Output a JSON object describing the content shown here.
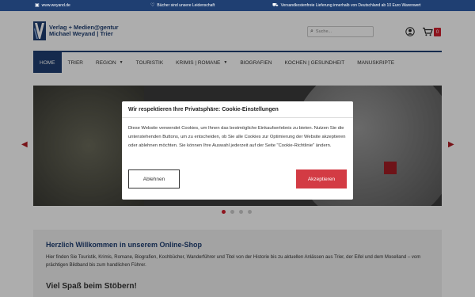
{
  "topbar": {
    "site_url": "www.weyand.de",
    "readership": "Bücher sind unsere Leidenschaft",
    "delivery": "Versandkostenfreie Lieferung innerhalb von Deutschland ab 10 Euro Warenwert"
  },
  "logo": {
    "line1": "Verlag + Medien@gentur",
    "line2": "Michael Weyand | Trier"
  },
  "search": {
    "placeholder": "Suche..."
  },
  "cart": {
    "count": "0"
  },
  "nav": {
    "items": [
      {
        "label": "HOME"
      },
      {
        "label": "TRIER"
      },
      {
        "label": "REGION"
      },
      {
        "label": "TOURISTIK"
      },
      {
        "label": "KRIMIS | ROMANE"
      },
      {
        "label": "BIOGRAFIEN"
      },
      {
        "label": "KOCHEN | GESUNDHEIT"
      },
      {
        "label": "MANUSKRIPTE"
      }
    ]
  },
  "welcome": {
    "title": "Herzlich Willkommen in unserem Online-Shop",
    "text": "Hier finden Sie Touristik, Krimis, Romane, Biografien, Kochbücher, Wanderführer und Titel von der Historie bis zu aktuellen Anlässen aus Trier, der Eifel und dem Moselland – vom prächtigen Bildband bis zum handlichen Führer.",
    "subtitle": "Viel Spaß beim Stöbern!"
  },
  "cookie": {
    "title": "Wir respektieren Ihre Privatsphäre: Cookie-Einstellungen",
    "text": "Diese Website verwendet Cookies, um Ihnen das bestmögliche Einkaufserlebnis zu bieten. Nutzen Sie die untenstehenden Buttons, um zu entscheiden, ob Sie alle Cookies zur Optimierung der Website akzeptieren oder ablehnen möchten. Sie können Ihre Auswahl jederzeit auf der Seite \"Cookie-Richtlinie\" ändern.",
    "decline_label": "Ablehnen",
    "accept_label": "Akzeptieren"
  },
  "colors": {
    "brand": "#1f3f72",
    "accent": "#d11f2e"
  }
}
